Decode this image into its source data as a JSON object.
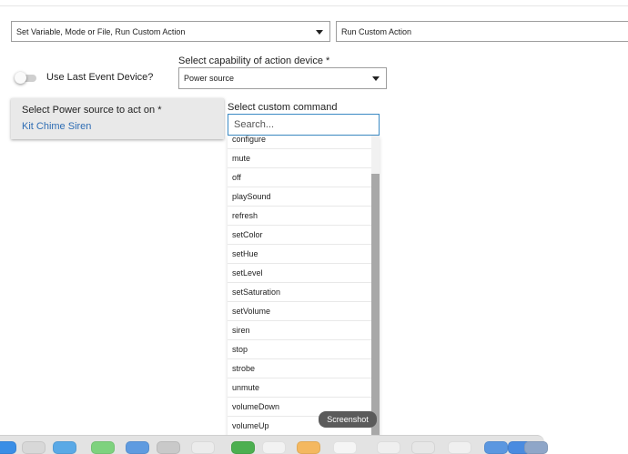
{
  "action_type_select": {
    "value": "Set Variable, Mode or File, Run Custom Action"
  },
  "action_select": {
    "value": "Run Custom Action"
  },
  "use_last_event_device": {
    "label": "Use Last Event Device?",
    "on": false
  },
  "capability": {
    "label": "Select capability of action device *",
    "value": "Power source"
  },
  "device_card": {
    "label": "Select Power source to act on *",
    "value": "Kit Chime Siren"
  },
  "custom_command": {
    "label": "Select custom command",
    "search_placeholder": "Search...",
    "items": [
      "configure",
      "mute",
      "off",
      "playSound",
      "refresh",
      "setColor",
      "setHue",
      "setLevel",
      "setSaturation",
      "setVolume",
      "siren",
      "stop",
      "strobe",
      "unmute",
      "volumeDown",
      "volumeUp"
    ]
  },
  "tooltip": {
    "text": "Screenshot"
  },
  "colors": {
    "link": "#2e6db4",
    "focus_border": "#3b8ac4",
    "card_bg": "#e9e9e9"
  },
  "dock": {
    "icons": [
      {
        "name": "finder-icon",
        "color": "#3a8ee6"
      },
      {
        "name": "launchpad-icon",
        "color": "#d8d8d8"
      },
      {
        "name": "safari-icon",
        "color": "#5aa9e6"
      },
      {
        "name": "messages-icon",
        "color": "#7ed27e"
      },
      {
        "name": "mail-icon",
        "color": "#5f9be0"
      },
      {
        "name": "contacts-icon",
        "color": "#c9c9c9"
      },
      {
        "name": "calendar-icon",
        "color": "#ececec"
      },
      {
        "name": "sheets-icon",
        "color": "#4caf50"
      },
      {
        "name": "notes-icon",
        "color": "#f2f2f2"
      },
      {
        "name": "photos-icon",
        "color": "#f4b860"
      },
      {
        "name": "reminders-icon",
        "color": "#f5f5f5"
      },
      {
        "name": "music-icon",
        "color": "#efefef"
      },
      {
        "name": "app-store-icon",
        "color": "#e7e7e7"
      },
      {
        "name": "system-preferences-icon",
        "color": "#f0f0f0"
      },
      {
        "name": "downloads-icon",
        "color": "#5b97e0"
      },
      {
        "name": "folder-icon",
        "color": "#4a8be0"
      },
      {
        "name": "trash-icon",
        "color": "#8fa6c8"
      }
    ]
  }
}
